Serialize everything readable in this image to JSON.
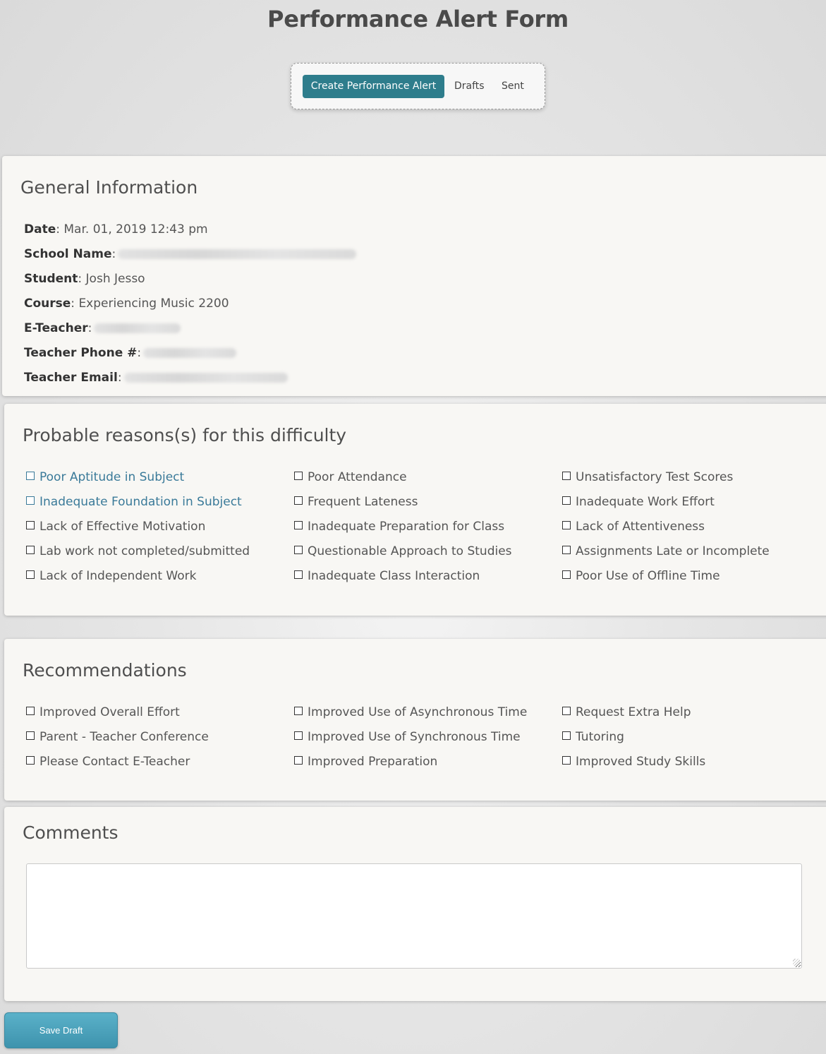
{
  "page": {
    "title": "Performance Alert Form"
  },
  "tabs": [
    {
      "label": "Create Performance Alert",
      "active": true
    },
    {
      "label": "Drafts",
      "active": false
    },
    {
      "label": "Sent",
      "active": false
    }
  ],
  "general": {
    "heading": "General Information",
    "fields": [
      {
        "label": "Date",
        "value": "Mar. 01, 2019 12:43 pm",
        "redacted": false
      },
      {
        "label": "School Name",
        "value": "",
        "redacted": true
      },
      {
        "label": "Student",
        "value": "Josh Jesso",
        "redacted": false
      },
      {
        "label": "Course",
        "value": "Experiencing Music 2200",
        "redacted": false
      },
      {
        "label": "E-Teacher",
        "value": "",
        "redacted": true
      },
      {
        "label": "Teacher Phone #",
        "value": "",
        "redacted": true
      },
      {
        "label": "Teacher Email",
        "value": "",
        "redacted": true
      }
    ]
  },
  "reasons": {
    "heading": "Probable reasons(s) for this difficulty",
    "columns": [
      [
        "Poor Aptitude in Subject",
        "Inadequate Foundation in Subject",
        "Lack of Effective Motivation",
        "Lab work not completed/submitted",
        "Lack of Independent Work"
      ],
      [
        "Poor Attendance",
        "Frequent Lateness",
        "Inadequate Preparation for Class",
        "Questionable Approach to Studies",
        "Inadequate Class Interaction"
      ],
      [
        "Unsatisfactory Test Scores",
        "Inadequate Work Effort",
        "Lack of Attentiveness",
        "Assignments Late or Incomplete",
        "Poor Use of Offline Time"
      ]
    ]
  },
  "recommendations": {
    "heading": "Recommendations",
    "columns": [
      [
        "Improved Overall Effort",
        "Parent - Teacher Conference",
        "Please Contact E-Teacher"
      ],
      [
        "Improved Use of Asynchronous Time",
        "Improved Use of Synchronous Time",
        "Improved Preparation"
      ],
      [
        "Request Extra Help",
        "Tutoring",
        "Improved Study Skills"
      ]
    ]
  },
  "comments": {
    "heading": "Comments",
    "value": ""
  },
  "actions": {
    "save_label": "Save Draft"
  },
  "colors": {
    "accent": "#2e7d8c",
    "link": "#3a7a99",
    "button": "#4aa0b9"
  }
}
